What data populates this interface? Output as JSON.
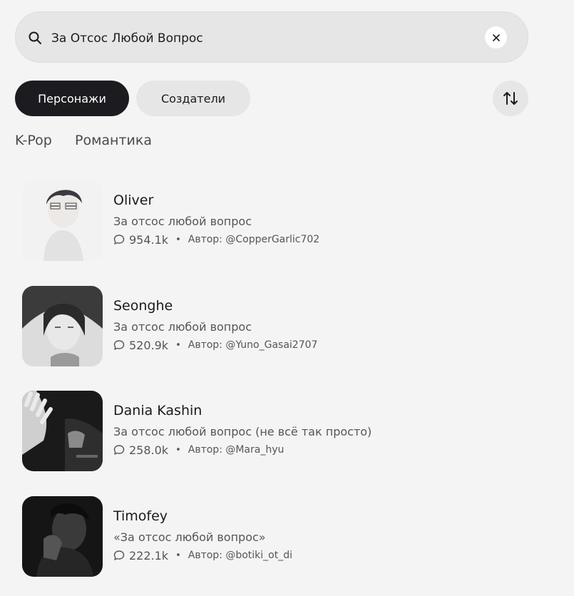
{
  "search": {
    "value": "За Отсос Любой Вопрос",
    "placeholder": ""
  },
  "tabs": [
    {
      "label": "Персонажи",
      "active": true
    },
    {
      "label": "Создатели",
      "active": false
    }
  ],
  "tags": [
    "K-Pop",
    "Романтика"
  ],
  "results": [
    {
      "name": "Oliver",
      "description": "За отсос любой вопрос",
      "chats": "954.1k",
      "author": "Автор: @CopperGarlic702",
      "avatar_icon": "avatar-image"
    },
    {
      "name": "Seonghe",
      "description": "За отсос любой вопрос",
      "chats": "520.9k",
      "author": "Автор: @Yuno_Gasai2707",
      "avatar_icon": "avatar-image"
    },
    {
      "name": "Dania Kashin",
      "description": "За отсос любой вопрос (не всё так просто)",
      "chats": "258.0k",
      "author": "Автор: @Mara_hyu",
      "avatar_icon": "avatar-image"
    },
    {
      "name": "Timofey",
      "description": "«За отсос любой вопрос»",
      "chats": "222.1k",
      "author": "Автор: @botiki_ot_di",
      "avatar_icon": "avatar-image"
    }
  ],
  "colors": {
    "background": "#f4f4f4",
    "active_tab": "#1c1c20",
    "pill": "#e6e6e7",
    "text_primary": "#1b1b1e",
    "text_secondary": "#55555b"
  }
}
